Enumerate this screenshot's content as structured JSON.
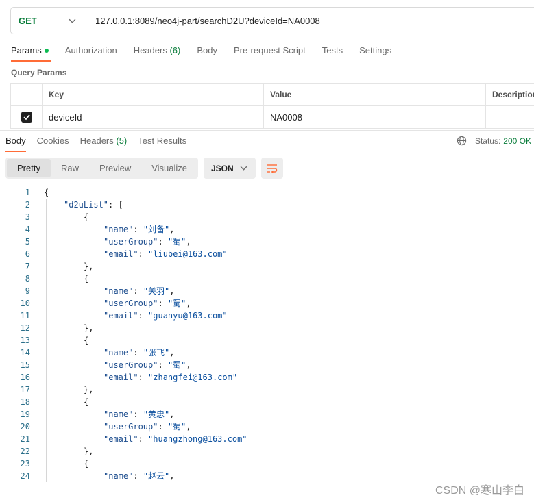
{
  "request": {
    "method": "GET",
    "url": "127.0.0.1:8089/neo4j-part/searchD2U?deviceId=NA0008"
  },
  "request_tabs": {
    "params": "Params",
    "authorization": "Authorization",
    "headers": "Headers",
    "headers_count": "(6)",
    "body": "Body",
    "prerequest": "Pre-request Script",
    "tests": "Tests",
    "settings": "Settings"
  },
  "query_params": {
    "title": "Query Params",
    "col_key": "Key",
    "col_value": "Value",
    "col_description": "Description",
    "rows": [
      {
        "key": "deviceId",
        "value": "NA0008",
        "checked": true
      }
    ]
  },
  "response_tabs": {
    "body": "Body",
    "cookies": "Cookies",
    "headers": "Headers",
    "headers_count": "(5)",
    "test_results": "Test Results"
  },
  "status": {
    "label": "Status:",
    "code": "200 OK"
  },
  "view": {
    "pretty": "Pretty",
    "raw": "Raw",
    "preview": "Preview",
    "visualize": "Visualize",
    "format": "JSON"
  },
  "response_body": {
    "list_key": "d2uList",
    "items": [
      {
        "name": "刘备",
        "userGroup": "蜀",
        "email": "liubei@163.com"
      },
      {
        "name": "关羽",
        "userGroup": "蜀",
        "email": "guanyu@163.com"
      },
      {
        "name": "张飞",
        "userGroup": "蜀",
        "email": "zhangfei@163.com"
      },
      {
        "name": "黄忠",
        "userGroup": "蜀",
        "email": "huangzhong@163.com"
      },
      {
        "name": "赵云"
      }
    ]
  },
  "watermark": "CSDN @寒山李白",
  "colors": {
    "accent": "#ff6c37",
    "method_green": "#0a7d3b",
    "status_green": "#0a7d3b"
  }
}
